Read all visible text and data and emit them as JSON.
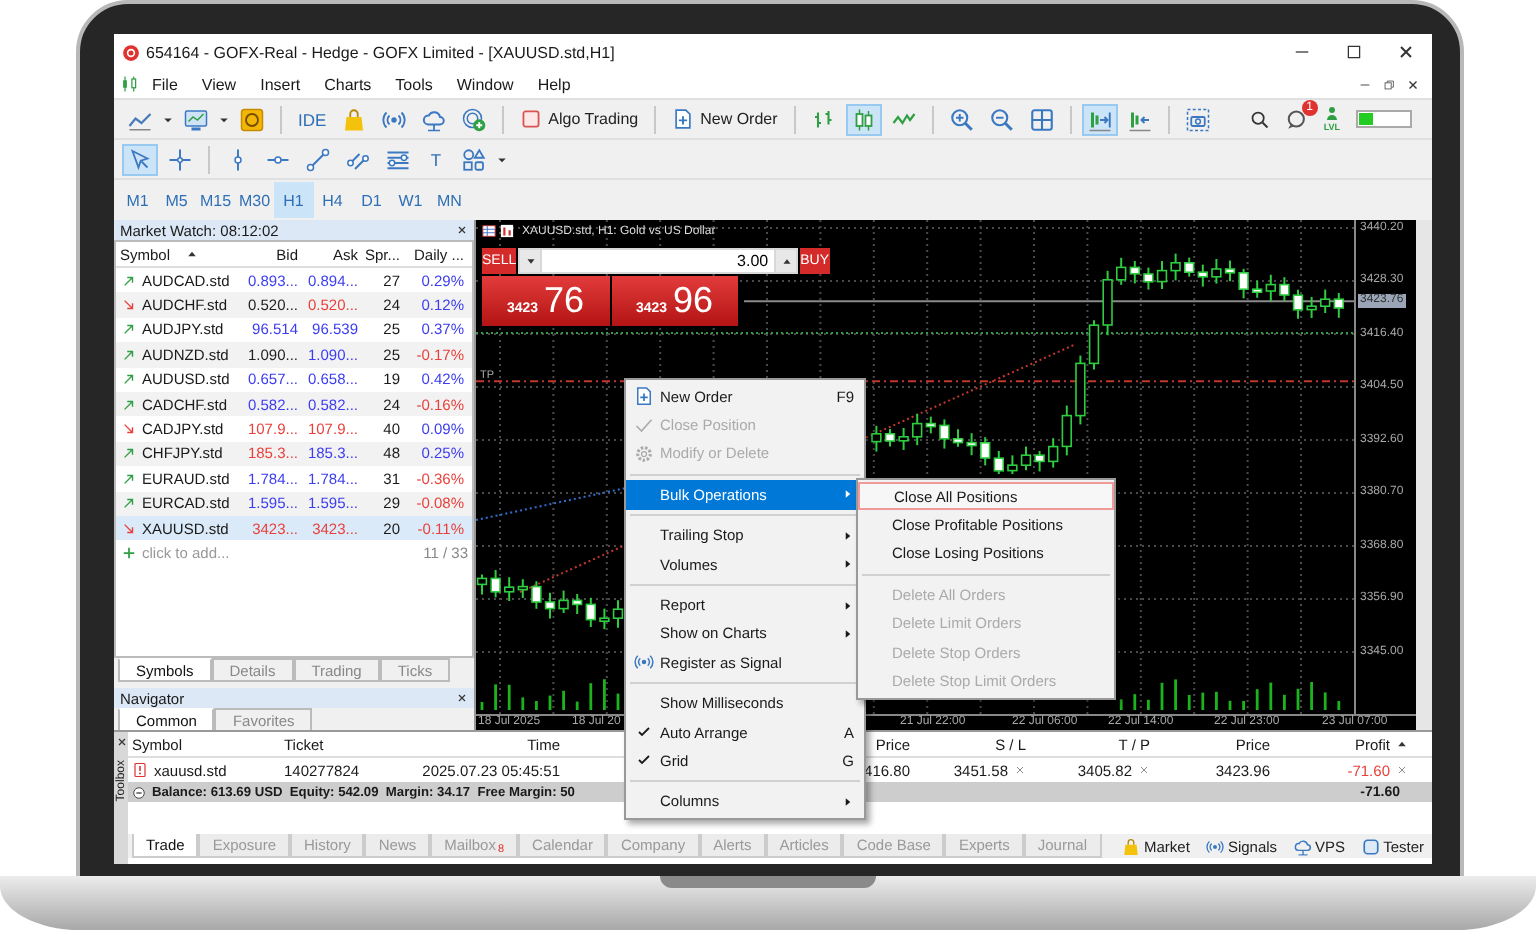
{
  "window": {
    "title": "654164 - GOFX-Real - Hedge - GOFX Limited - [XAUUSD.std,H1]"
  },
  "menu": [
    "File",
    "View",
    "Insert",
    "Charts",
    "Tools",
    "Window",
    "Help"
  ],
  "toolbar": [
    {
      "kind": "icon",
      "selected": false
    },
    {
      "kind": "caret"
    },
    {
      "kind": "icon",
      "selected": false
    },
    {
      "kind": "caret"
    },
    {
      "kind": "icon",
      "selected": false
    },
    {
      "kind": "separator"
    },
    {
      "kind": "text",
      "label": "IDE",
      "selected": false
    },
    {
      "kind": "icon",
      "selected": false
    },
    {
      "kind": "icon",
      "selected": false
    },
    {
      "kind": "icon",
      "selected": false
    },
    {
      "kind": "icon",
      "selected": false
    },
    {
      "kind": "separator"
    },
    {
      "kind": "labeled",
      "label": "Algo Trading",
      "selected": false
    },
    {
      "kind": "separator"
    },
    {
      "kind": "labeled",
      "label": "New Order",
      "selected": false
    },
    {
      "kind": "separator"
    },
    {
      "kind": "icon",
      "selected": false
    },
    {
      "kind": "icon",
      "selected": true
    },
    {
      "kind": "icon",
      "selected": false
    },
    {
      "kind": "separator"
    },
    {
      "kind": "icon",
      "selected": false
    },
    {
      "kind": "icon",
      "selected": false
    },
    {
      "kind": "icon",
      "selected": false
    },
    {
      "kind": "separator"
    },
    {
      "kind": "icon",
      "selected": true
    },
    {
      "kind": "icon",
      "selected": false
    },
    {
      "kind": "separator"
    },
    {
      "kind": "icon",
      "selected": false
    }
  ],
  "toolbar_right": {
    "notifications": "1",
    "level_badge": "LVL"
  },
  "drawing_tools": [
    {
      "kind": "icon",
      "selected": true
    },
    {
      "kind": "icon",
      "selected": false
    },
    {
      "kind": "separator"
    },
    {
      "kind": "icon",
      "selected": false
    },
    {
      "kind": "icon",
      "selected": false
    },
    {
      "kind": "icon",
      "selected": false
    },
    {
      "kind": "icon",
      "selected": false
    },
    {
      "kind": "icon",
      "selected": false
    },
    {
      "kind": "text",
      "label": "T",
      "selected": false
    },
    {
      "kind": "icon",
      "selected": false
    },
    {
      "kind": "caret"
    }
  ],
  "timeframes": [
    {
      "label": "M1",
      "selected": false
    },
    {
      "label": "M5",
      "selected": false
    },
    {
      "label": "M15",
      "selected": false
    },
    {
      "label": "M30",
      "selected": false
    },
    {
      "label": "H1",
      "selected": true
    },
    {
      "label": "H4",
      "selected": false
    },
    {
      "label": "D1",
      "selected": false
    },
    {
      "label": "W1",
      "selected": false
    },
    {
      "label": "MN",
      "selected": false
    }
  ],
  "market_watch": {
    "title": "Market Watch: 08:12:02",
    "columns": [
      "Symbol",
      "Bid",
      "Ask",
      "Spr...",
      "Daily ..."
    ],
    "rows": [
      {
        "symbol": "AUDCAD.std",
        "rising": true,
        "bid": {
          "text": "0.893...",
          "color": "#3c3cf0"
        },
        "ask": {
          "text": "0.894...",
          "color": "#3c3cf0"
        },
        "spread": "27",
        "daily": {
          "text": "0.29%",
          "color": "#3c3cf0"
        },
        "selected": false
      },
      {
        "symbol": "AUDCHF.std",
        "rising": false,
        "bid": {
          "text": "0.520...",
          "color": "#222222"
        },
        "ask": {
          "text": "0.520...",
          "color": "#e8413c"
        },
        "spread": "24",
        "daily": {
          "text": "0.12%",
          "color": "#3c3cf0"
        },
        "selected": false
      },
      {
        "symbol": "AUDJPY.std",
        "rising": true,
        "bid": {
          "text": "96.514",
          "color": "#3c3cf0"
        },
        "ask": {
          "text": "96.539",
          "color": "#3c3cf0"
        },
        "spread": "25",
        "daily": {
          "text": "0.37%",
          "color": "#3c3cf0"
        },
        "selected": false
      },
      {
        "symbol": "AUDNZD.std",
        "rising": true,
        "bid": {
          "text": "1.090...",
          "color": "#222222"
        },
        "ask": {
          "text": "1.090...",
          "color": "#3c3cf0"
        },
        "spread": "25",
        "daily": {
          "text": "-0.17%",
          "color": "#e8413c"
        },
        "selected": false
      },
      {
        "symbol": "AUDUSD.std",
        "rising": true,
        "bid": {
          "text": "0.657...",
          "color": "#3c3cf0"
        },
        "ask": {
          "text": "0.658...",
          "color": "#3c3cf0"
        },
        "spread": "19",
        "daily": {
          "text": "0.42%",
          "color": "#3c3cf0"
        },
        "selected": false
      },
      {
        "symbol": "CADCHF.std",
        "rising": true,
        "bid": {
          "text": "0.582...",
          "color": "#3c3cf0"
        },
        "ask": {
          "text": "0.582...",
          "color": "#3c3cf0"
        },
        "spread": "24",
        "daily": {
          "text": "-0.16%",
          "color": "#e8413c"
        },
        "selected": false
      },
      {
        "symbol": "CADJPY.std",
        "rising": false,
        "bid": {
          "text": "107.9...",
          "color": "#e8413c"
        },
        "ask": {
          "text": "107.9...",
          "color": "#e8413c"
        },
        "spread": "40",
        "daily": {
          "text": "0.09%",
          "color": "#3c3cf0"
        },
        "selected": false
      },
      {
        "symbol": "CHFJPY.std",
        "rising": true,
        "bid": {
          "text": "185.3...",
          "color": "#e8413c"
        },
        "ask": {
          "text": "185.3...",
          "color": "#3c3cf0"
        },
        "spread": "48",
        "daily": {
          "text": "0.25%",
          "color": "#3c3cf0"
        },
        "selected": false
      },
      {
        "symbol": "EURAUD.std",
        "rising": true,
        "bid": {
          "text": "1.784...",
          "color": "#3c3cf0"
        },
        "ask": {
          "text": "1.784...",
          "color": "#3c3cf0"
        },
        "spread": "31",
        "daily": {
          "text": "-0.36%",
          "color": "#e8413c"
        },
        "selected": false
      },
      {
        "symbol": "EURCAD.std",
        "rising": true,
        "bid": {
          "text": "1.595...",
          "color": "#3c3cf0"
        },
        "ask": {
          "text": "1.595...",
          "color": "#3c3cf0"
        },
        "spread": "29",
        "daily": {
          "text": "-0.08%",
          "color": "#e8413c"
        },
        "selected": false
      },
      {
        "symbol": "XAUUSD.std",
        "rising": false,
        "bid": {
          "text": "3423...",
          "color": "#e8413c"
        },
        "ask": {
          "text": "3423...",
          "color": "#e8413c"
        },
        "spread": "20",
        "daily": {
          "text": "-0.11%",
          "color": "#e8413c"
        },
        "selected": true
      }
    ],
    "add_placeholder": "click to add...",
    "count": "11 / 33",
    "tabs": [
      {
        "label": "Symbols",
        "selected": true
      },
      {
        "label": "Details",
        "selected": false
      },
      {
        "label": "Trading",
        "selected": false
      },
      {
        "label": "Ticks",
        "selected": false
      }
    ]
  },
  "navigator": {
    "title": "Navigator",
    "tabs": [
      {
        "label": "Common",
        "selected": true
      },
      {
        "label": "Favorites",
        "selected": false
      }
    ]
  },
  "chart": {
    "title": "XAUUSD.std, H1:  Gold vs US Dollar",
    "order_panel": {
      "sell_label": "SELL",
      "buy_label": "BUY",
      "volume": "3.00",
      "sell_main": "3423",
      "sell_big": "76",
      "buy_main": "3423",
      "buy_big": "96"
    },
    "tp_label": "TP",
    "price_axis": [
      "3440.20",
      "3428.30",
      "3416.40",
      "3404.50",
      "3392.60",
      "3380.70",
      "3368.80",
      "3356.90",
      "3345.00"
    ],
    "current_price": "3423.76",
    "time_axis": [
      "18 Jul 2025",
      "18 Jul 20",
      "21 Jul 22:00",
      "22 Jul 06:00",
      "22 Jul 14:00",
      "22 Jul 23:00",
      "23 Jul 07:00"
    ]
  },
  "context_menu": {
    "items": [
      {
        "kind": "item",
        "label": "New Order",
        "shortcut": "F9",
        "disabled": false,
        "checked": false,
        "selected": false,
        "submenu": false
      },
      {
        "kind": "item",
        "label": "Close Position",
        "disabled": true,
        "checked": false,
        "selected": false,
        "submenu": false
      },
      {
        "kind": "item",
        "label": "Modify or Delete",
        "disabled": true,
        "checked": false,
        "selected": false,
        "submenu": false
      },
      {
        "kind": "separator"
      },
      {
        "kind": "item",
        "label": "Bulk Operations",
        "disabled": false,
        "checked": false,
        "selected": true,
        "submenu": true
      },
      {
        "kind": "separator"
      },
      {
        "kind": "item",
        "label": "Trailing Stop",
        "disabled": false,
        "checked": false,
        "selected": false,
        "submenu": true
      },
      {
        "kind": "item",
        "label": "Volumes",
        "disabled": false,
        "checked": false,
        "selected": false,
        "submenu": true
      },
      {
        "kind": "separator"
      },
      {
        "kind": "item",
        "label": "Report",
        "disabled": false,
        "checked": false,
        "selected": false,
        "submenu": true
      },
      {
        "kind": "item",
        "label": "Show on Charts",
        "disabled": false,
        "checked": false,
        "selected": false,
        "submenu": true
      },
      {
        "kind": "item",
        "label": "Register as Signal",
        "disabled": false,
        "checked": false,
        "selected": false,
        "submenu": false
      },
      {
        "kind": "separator"
      },
      {
        "kind": "item",
        "label": "Show Milliseconds",
        "disabled": false,
        "checked": false,
        "selected": false,
        "submenu": false
      },
      {
        "kind": "item",
        "label": "Auto Arrange",
        "shortcut": "A",
        "disabled": false,
        "checked": true,
        "selected": false,
        "submenu": false
      },
      {
        "kind": "item",
        "label": "Grid",
        "shortcut": "G",
        "disabled": false,
        "checked": true,
        "selected": false,
        "submenu": false
      },
      {
        "kind": "separator"
      },
      {
        "kind": "item",
        "label": "Columns",
        "disabled": false,
        "checked": false,
        "selected": false,
        "submenu": true
      }
    ],
    "submenu": [
      {
        "kind": "item",
        "label": "Close All Positions",
        "disabled": false,
        "selected": true
      },
      {
        "kind": "item",
        "label": "Close Profitable Positions",
        "disabled": false,
        "selected": false
      },
      {
        "kind": "item",
        "label": "Close Losing Positions",
        "disabled": false,
        "selected": false
      },
      {
        "kind": "separator"
      },
      {
        "kind": "item",
        "label": "Delete All Orders",
        "disabled": true,
        "selected": false
      },
      {
        "kind": "item",
        "label": "Delete Limit Orders",
        "disabled": true,
        "selected": false
      },
      {
        "kind": "item",
        "label": "Delete Stop Orders",
        "disabled": true,
        "selected": false
      },
      {
        "kind": "item",
        "label": "Delete Stop Limit Orders",
        "disabled": true,
        "selected": false
      }
    ]
  },
  "toolbox": {
    "label": "Toolbox",
    "columns": [
      "Symbol",
      "Ticket",
      "Time",
      "Price",
      "S / L",
      "T / P",
      "Price",
      "Profit"
    ],
    "positions": [
      {
        "symbol": "xauusd.std",
        "ticket": "140277824",
        "time": "2025.07.23 05:45:51",
        "price": "416.80",
        "sl": "3451.58",
        "tp": "3405.82",
        "current": "3423.96",
        "profit": {
          "text": "-71.60",
          "color": "#e8413c"
        }
      }
    ],
    "summary": {
      "text": "Balance: 613.69 USD  Equity: 542.09  Margin: 34.17  Free Margin: 50",
      "total": "-71.60"
    },
    "tabs": [
      {
        "label": "Trade",
        "selected": true
      },
      {
        "label": "Exposure",
        "selected": false
      },
      {
        "label": "History",
        "selected": false
      },
      {
        "label": "News",
        "selected": false
      },
      {
        "label": "Mailbox",
        "badge": "8",
        "selected": false
      },
      {
        "label": "Calendar",
        "selected": false
      },
      {
        "label": "Company",
        "selected": false
      },
      {
        "label": "Alerts",
        "selected": false
      },
      {
        "label": "Articles",
        "selected": false
      },
      {
        "label": "Code Base",
        "selected": false
      },
      {
        "label": "Experts",
        "selected": false
      },
      {
        "label": "Journal",
        "selected": false
      }
    ],
    "services": [
      "Market",
      "Signals",
      "VPS",
      "Tester"
    ]
  }
}
